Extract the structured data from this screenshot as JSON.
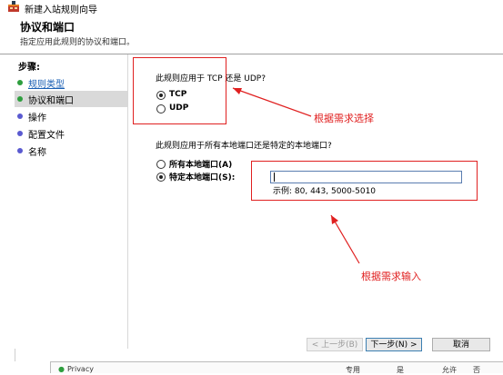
{
  "window": {
    "title": "新建入站规则向导",
    "icon": "firewall-rule-icon"
  },
  "header": {
    "title": "协议和端口",
    "subtitle": "指定应用此规则的协议和端口。"
  },
  "steps": {
    "title": "步骤:",
    "items": [
      {
        "label": "规则类型",
        "color": "#2e9e3e",
        "state": "done"
      },
      {
        "label": "协议和端口",
        "color": "#2e9e3e",
        "state": "active"
      },
      {
        "label": "操作",
        "color": "#5a5ad0",
        "state": "pending"
      },
      {
        "label": "配置文件",
        "color": "#5a5ad0",
        "state": "pending"
      },
      {
        "label": "名称",
        "color": "#5a5ad0",
        "state": "pending"
      }
    ]
  },
  "protocol": {
    "question": "此规则应用于 TCP 还是 UDP?",
    "options": [
      {
        "label": "TCP",
        "selected": true
      },
      {
        "label": "UDP",
        "selected": false
      }
    ]
  },
  "ports": {
    "question": "此规则应用于所有本地端口还是特定的本地端口?",
    "options": [
      {
        "label": "所有本地端口(A)",
        "selected": false
      },
      {
        "label": "特定本地端口(S):",
        "selected": true
      }
    ],
    "input_value": "",
    "example": "示例: 80, 443, 5000-5010"
  },
  "annotations": {
    "select_hint": "根据需求选择",
    "input_hint": "根据需求输入",
    "color": "#e02020"
  },
  "buttons": {
    "back": "< 上一步(B)",
    "next": "下一步(N) >",
    "cancel": "取消"
  },
  "background_window": {
    "row_label": "Privacy",
    "col1": "专用",
    "col2": "是",
    "col3": "允许",
    "col4": "否"
  }
}
